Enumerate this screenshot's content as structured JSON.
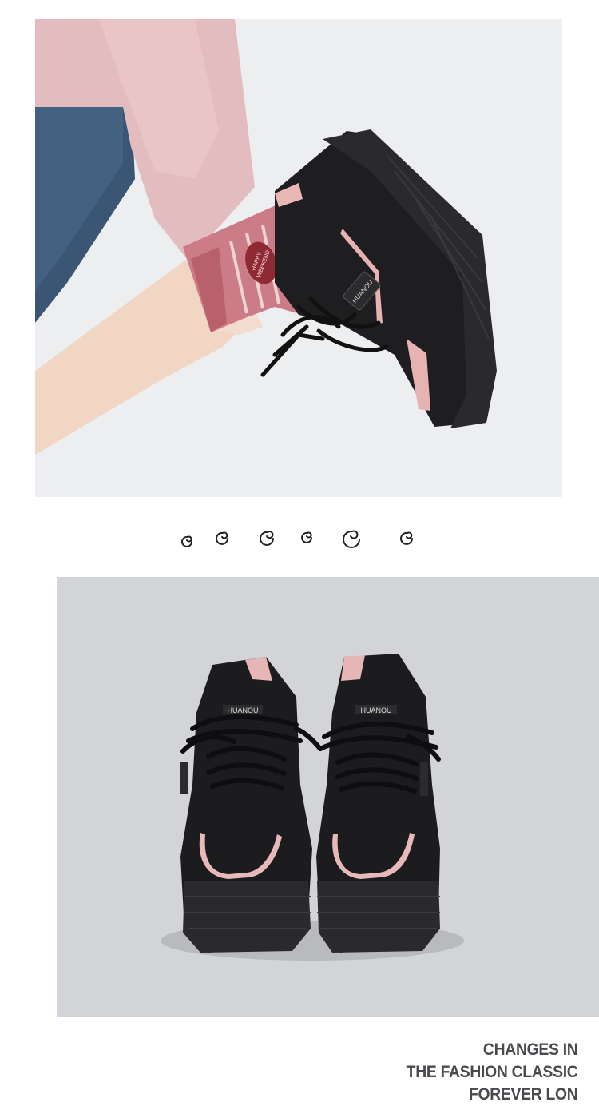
{
  "photos": {
    "top": {
      "subject": "foot in pink sock wearing black and pink platform sneaker",
      "sock_text": "HAPPY WEEKEND",
      "shoe_tag": "HUANOU"
    },
    "bottom": {
      "subject": "pair of black and pink platform sneakers, front view",
      "shoe_tag": "HUANOU"
    }
  },
  "decoration": {
    "icon": "spiral-doodle",
    "count": 6
  },
  "caption": {
    "line1": "CHANGES IN",
    "line2": "THE FASHION CLASSIC",
    "line3": "FOREVER LON"
  },
  "colors": {
    "text": "#4a4a4e",
    "sneaker": "#1c1c1e",
    "accent_pink": "#e8b9b9"
  }
}
